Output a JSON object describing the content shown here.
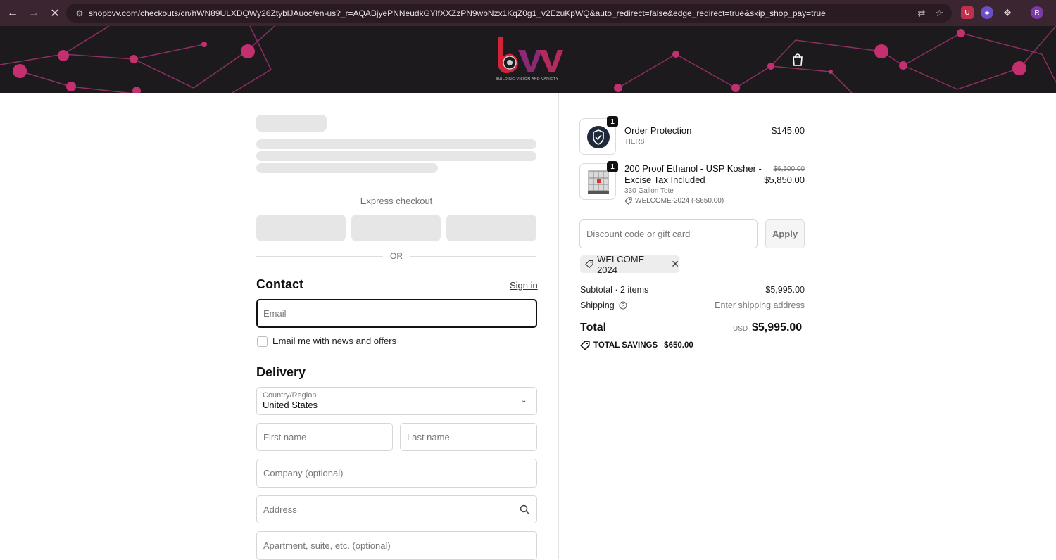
{
  "browser": {
    "url": "shopbvv.com/checkouts/cn/hWN89ULXDQWy26ZtyblJAuoc/en-us?_r=AQABjyePNNeudkGYlfXXZzPN9wbNzx1KqZ0g1_v2EzuKpWQ&auto_redirect=false&edge_redirect=true&skip_shop_pay=true",
    "profile_initial": "R"
  },
  "header": {
    "logo_text": "bvv",
    "tagline": "BUILDING VISION AND VARIETY"
  },
  "checkout": {
    "express_checkout_label": "Express checkout",
    "or_label": "OR",
    "contact": {
      "title": "Contact",
      "sign_in": "Sign in",
      "email_placeholder": "Email",
      "newsletter_label": "Email me with news and offers"
    },
    "delivery": {
      "title": "Delivery",
      "country_label": "Country/Region",
      "country_value": "United States",
      "first_name_placeholder": "First name",
      "last_name_placeholder": "Last name",
      "company_placeholder": "Company (optional)",
      "address_placeholder": "Address",
      "apartment_placeholder": "Apartment, suite, etc. (optional)"
    }
  },
  "summary": {
    "items": [
      {
        "quantity": "1",
        "title": "Order Protection",
        "variant": "TIER8",
        "price": "$145.00"
      },
      {
        "quantity": "1",
        "title_line1": "200 Proof Ethanol - USP Kosher -",
        "title_line2": "Excise Tax Included",
        "variant": "330 Gallon Tote",
        "discount": "WELCOME-2024 (-$650.00)",
        "original_price": "$6,500.00",
        "price": "$5,850.00"
      }
    ],
    "discount_placeholder": "Discount code or gift card",
    "apply_label": "Apply",
    "applied_code": "WELCOME-2024",
    "subtotal_label": "Subtotal · 2 items",
    "subtotal_value": "$5,995.00",
    "shipping_label": "Shipping",
    "shipping_value": "Enter shipping address",
    "total_label": "Total",
    "currency": "USD",
    "total_value": "$5,995.00",
    "savings_label": "TOTAL SAVINGS",
    "savings_value": "$650.00"
  }
}
